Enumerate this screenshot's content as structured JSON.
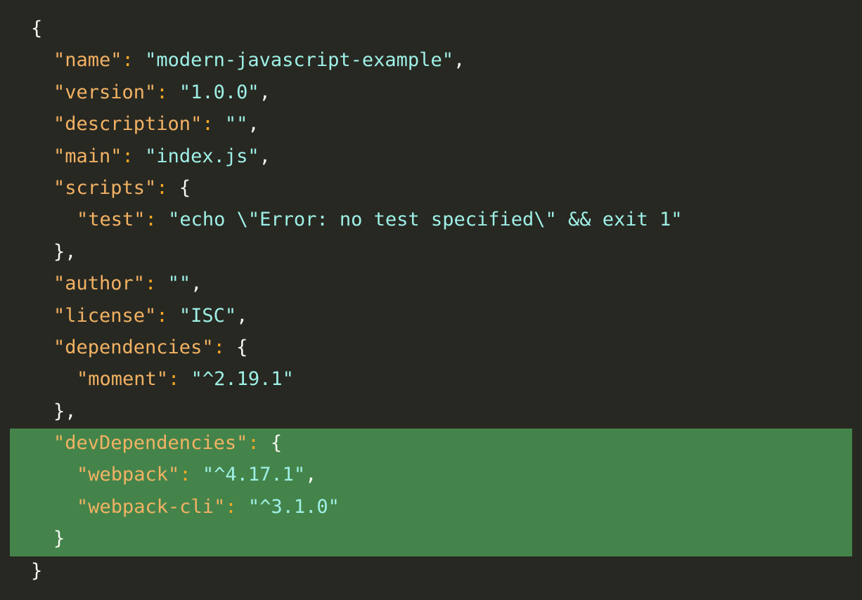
{
  "code": {
    "open_brace": "{",
    "close_brace": "}",
    "lines": [
      {
        "key": "\"name\"",
        "colon": ": ",
        "value": "\"modern-javascript-example\"",
        "suffix": ","
      },
      {
        "key": "\"version\"",
        "colon": ": ",
        "value": "\"1.0.0\"",
        "suffix": ","
      },
      {
        "key": "\"description\"",
        "colon": ": ",
        "value": "\"\"",
        "suffix": ","
      },
      {
        "key": "\"main\"",
        "colon": ": ",
        "value": "\"index.js\"",
        "suffix": ","
      },
      {
        "key": "\"scripts\"",
        "colon": ": ",
        "suffix": "{"
      },
      {
        "key": "\"test\"",
        "colon": ": ",
        "value": "\"echo \\\"Error: no test specified\\\" && exit 1\""
      },
      {
        "suffix": "},"
      },
      {
        "key": "\"author\"",
        "colon": ": ",
        "value": "\"\"",
        "suffix": ","
      },
      {
        "key": "\"license\"",
        "colon": ": ",
        "value": "\"ISC\"",
        "suffix": ","
      },
      {
        "key": "\"dependencies\"",
        "colon": ": ",
        "suffix": "{"
      },
      {
        "key": "\"moment\"",
        "colon": ": ",
        "value": "\"^2.19.1\""
      },
      {
        "suffix": "},"
      },
      {
        "key": "\"devDependencies\"",
        "colon": ": ",
        "suffix": "{"
      },
      {
        "key": "\"webpack\"",
        "colon": ": ",
        "value": "\"^4.17.1\"",
        "suffix": ","
      },
      {
        "key": "\"webpack-cli\"",
        "colon": ": ",
        "value": "\"^3.1.0\""
      },
      {
        "suffix": "}"
      }
    ]
  },
  "colors": {
    "background": "#272822",
    "highlight": "#44844b",
    "key": "#f2b263",
    "string": "#9ff0e6",
    "punctuation": "#f8f8f2"
  }
}
